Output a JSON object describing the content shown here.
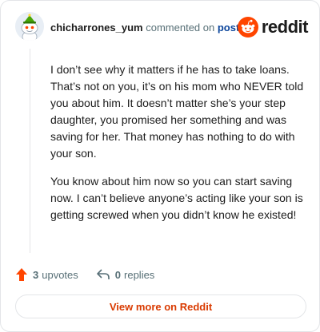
{
  "header": {
    "username": "chicharrones_yum",
    "action": "commented on",
    "post_link": "post",
    "brand": "reddit"
  },
  "comment": {
    "paragraphs": [
      "I don’t see why it matters if he has to take loans. That’s not on you, it’s on his mom who NEVER told you about him. It doesn’t matter she’s your step daughter, you promised her something and was saving for her. That money has nothing to do with your son.",
      "You know about him now so you can start saving now. I can’t believe anyone’s acting like your son is getting screwed when you didn’t know he existed!"
    ]
  },
  "stats": {
    "upvotes_count": "3",
    "upvotes_label": "upvotes",
    "replies_count": "0",
    "replies_label": "replies"
  },
  "footer": {
    "view_more_label": "View more on Reddit"
  },
  "colors": {
    "brand": "#ff4500",
    "upvote": "#ff4500",
    "link": "#0a449b",
    "view_more": "#d93a00"
  },
  "icons": [
    "avatar-icon",
    "reddit-logo-icon",
    "upvote-arrow-icon",
    "reply-arrow-icon"
  ]
}
